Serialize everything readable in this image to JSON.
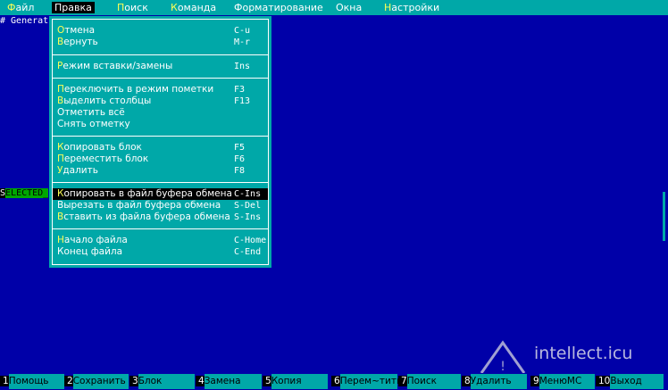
{
  "menubar": {
    "items": [
      {
        "label": "Файл",
        "hotkey": "Ф",
        "rest": "айл"
      },
      {
        "label": "Правка",
        "hotkey": "",
        "rest": "Правка"
      },
      {
        "label": "Поиск",
        "hotkey": "П",
        "rest": "оиск"
      },
      {
        "label": "Команда",
        "hotkey": "К",
        "rest": "оманда"
      },
      {
        "label": "Форматирование",
        "hotkey": "",
        "rest": "Форматирование"
      },
      {
        "label": "Окна",
        "hotkey": "",
        "rest": "Окна"
      },
      {
        "label": "Настройки",
        "hotkey": "Н",
        "rest": "астройки"
      }
    ]
  },
  "editor": {
    "first_line": "# Generat",
    "selected_cursor": "S",
    "selected_text": "ELECTED_"
  },
  "dropdown": {
    "items": [
      {
        "hk": "О",
        "rest": "тмена",
        "shortcut": "C-u"
      },
      {
        "hk": "В",
        "rest": "ернуть",
        "shortcut": "M-r"
      },
      {
        "hk": "Р",
        "rest": "ежим вставки/замены",
        "shortcut": "Ins"
      },
      {
        "hk": "П",
        "rest": "ереключить в режим пометки",
        "shortcut": "F3"
      },
      {
        "hk": "В",
        "rest": "ыделить столбцы",
        "shortcut": "F13"
      },
      {
        "hk": "",
        "rest": "Отметить всё",
        "shortcut": ""
      },
      {
        "hk": "",
        "rest": "Снять отметку",
        "shortcut": ""
      },
      {
        "hk": "К",
        "rest": "опировать блок",
        "shortcut": "F5"
      },
      {
        "hk": "П",
        "rest": "ереместить блок",
        "shortcut": "F6"
      },
      {
        "hk": "У",
        "rest": "далить",
        "shortcut": "F8"
      },
      {
        "hk": "К",
        "rest": "опировать в файл буфера обмена",
        "shortcut": "C-Ins"
      },
      {
        "hk": "",
        "rest": "Вырезать в файл буфера обмена",
        "shortcut": "S-Del"
      },
      {
        "hk": "В",
        "rest": "ставить из файла буфера обмена",
        "shortcut": "S-Ins"
      },
      {
        "hk": "Н",
        "rest": "ачало файла",
        "shortcut": "C-Home"
      },
      {
        "hk": "",
        "rest": "Конец файла",
        "shortcut": "C-End"
      }
    ]
  },
  "fkeys": [
    {
      "num": "1",
      "label": "Помощь"
    },
    {
      "num": "2",
      "label": "Сохранить"
    },
    {
      "num": "3",
      "label": "Блок"
    },
    {
      "num": "4",
      "label": "Замена"
    },
    {
      "num": "5",
      "label": "Копия"
    },
    {
      "num": "6",
      "label": "Перем~тить"
    },
    {
      "num": "7",
      "label": "Поиск"
    },
    {
      "num": "8",
      "label": "Удалить"
    },
    {
      "num": "9",
      "label": "МенюМС"
    },
    {
      "num": "10",
      "label": "Выход"
    }
  ],
  "watermark": {
    "text": "intellect.icu"
  },
  "colors": {
    "background": "#0000a8",
    "menu": "#00a8a8",
    "hotkey": "#ffff55",
    "selection": "#000000",
    "selected_text_bg": "#00a800"
  }
}
